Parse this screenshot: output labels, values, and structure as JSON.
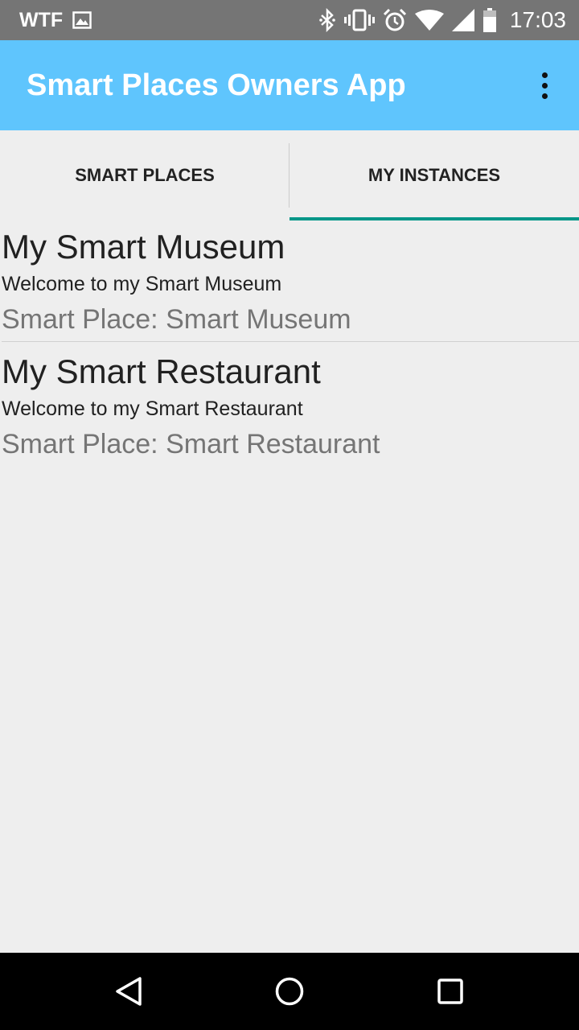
{
  "status_bar": {
    "carrier": "WTF",
    "time": "17:03",
    "icons": [
      "image-icon",
      "bluetooth-icon",
      "vibrate-icon",
      "alarm-icon",
      "wifi-icon",
      "signal-icon",
      "battery-icon"
    ]
  },
  "app_bar": {
    "title": "Smart Places Owners App",
    "background": "#5fc5fd"
  },
  "tabs": [
    {
      "label": "SMART PLACES",
      "selected": false
    },
    {
      "label": "MY INSTANCES",
      "selected": true
    }
  ],
  "colors": {
    "accent": "#009688"
  },
  "instances": [
    {
      "title": "My Smart Museum",
      "subtitle": "Welcome to my Smart Museum",
      "place": "Smart Place:  Smart Museum"
    },
    {
      "title": "My Smart Restaurant",
      "subtitle": "Welcome to my Smart Restaurant",
      "place": "Smart Place:  Smart Restaurant"
    }
  ]
}
